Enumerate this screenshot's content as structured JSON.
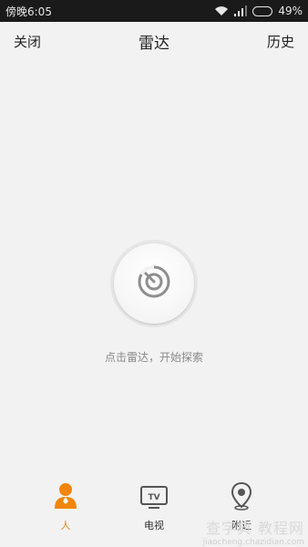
{
  "status_bar": {
    "time": "傍晚6:05",
    "battery_percent": "49%",
    "battery_level": 0.49
  },
  "header": {
    "left_button": "关闭",
    "title": "雷达",
    "right_button": "历史"
  },
  "radar": {
    "icon": "radar-icon",
    "hint": "点击雷达，开始探索"
  },
  "tabs": [
    {
      "label": "人",
      "icon": "person-icon",
      "active": true
    },
    {
      "label": "电视",
      "icon": "tv-icon",
      "active": false
    },
    {
      "label": "附近",
      "icon": "location-pin-icon",
      "active": false
    }
  ],
  "colors": {
    "accent": "#f2850d",
    "background": "#f2f2f2",
    "status_bar": "#1a1a1a"
  },
  "watermark": {
    "main": "查字典 教程网",
    "sub": "jiaocheng.chazidian.com"
  }
}
